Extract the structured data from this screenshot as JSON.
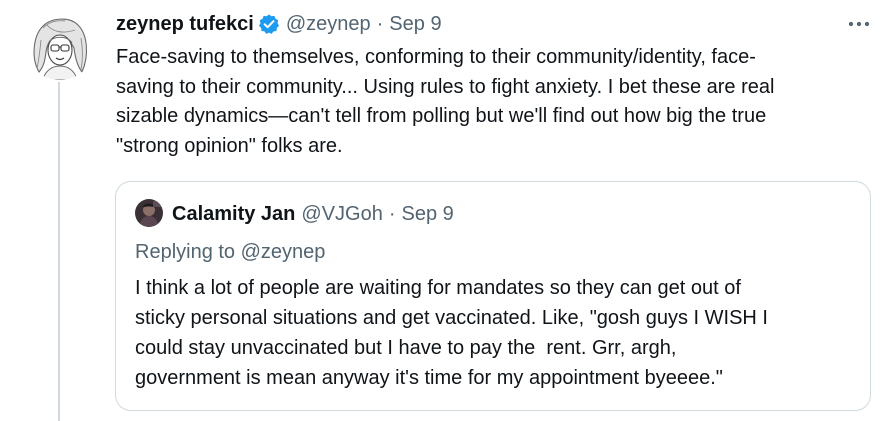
{
  "tweet": {
    "author": {
      "display_name": "zeynep tufekci",
      "handle": "@zeynep",
      "verified": true
    },
    "date": "Sep 9",
    "separator": "·",
    "text": "Face-saving to themselves, conforming to their community/identity, face-\nsaving to their community... Using rules to fight anxiety. I bet these are real\nsizable dynamics—can't tell from polling but we'll find out how big the true\n\"strong opinion\" folks are.",
    "more_icon": "more-horizontal-icon"
  },
  "quote": {
    "author": {
      "display_name": "Calamity Jan",
      "handle": "@VJGoh"
    },
    "date": "Sep 9",
    "separator": "·",
    "replying_prefix": "Replying to ",
    "replying_handle": "@zeynep",
    "text": "I think a lot of people are waiting for mandates so they can get out of\nsticky personal situations and get vaccinated. Like, \"gosh guys I WISH I\ncould stay unvaccinated but I have to pay the  rent. Grr, argh,\ngovernment is mean anyway it's time for my appointment byeeee.\""
  },
  "colors": {
    "text": "#0f1419",
    "secondary": "#536471",
    "border": "#cfd9de",
    "verified": "#1d9bf0"
  }
}
